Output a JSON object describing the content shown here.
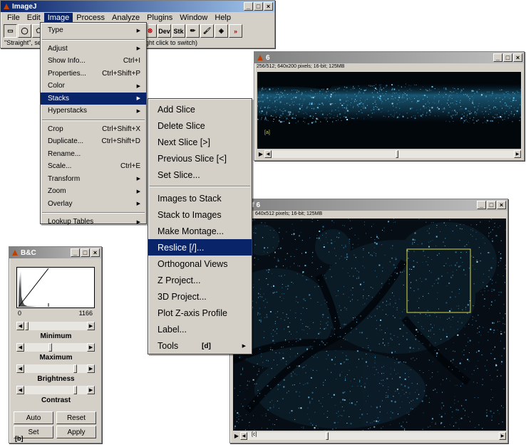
{
  "imagej": {
    "title": "ImageJ",
    "menus": [
      "File",
      "Edit",
      "Image",
      "Process",
      "Analyze",
      "Plugins",
      "Window",
      "Help"
    ],
    "active_menu": "Image",
    "tools": [
      {
        "name": "rectangle-tool-icon",
        "glyph": "▭"
      },
      {
        "name": "oval-tool-icon",
        "glyph": "◯"
      },
      {
        "name": "polygon-tool-icon",
        "glyph": "⬠"
      },
      {
        "name": "eyedropper-icon",
        "glyph": "✎"
      },
      {
        "name": "stop-icon",
        "glyph": "⊗"
      },
      {
        "name": "dev-tool-icon",
        "glyph": "Dev"
      },
      {
        "name": "stk-tool-icon",
        "glyph": "Stk"
      },
      {
        "name": "pencil-icon",
        "glyph": "✏"
      },
      {
        "name": "brush-icon",
        "glyph": "🖌"
      },
      {
        "name": "fill-bucket-icon",
        "glyph": "◈"
      },
      {
        "name": "more-tools-icon",
        "glyph": "»"
      }
    ],
    "status_left": "\"Straight\", se",
    "status_right": "ght click to switch)"
  },
  "image_menu": {
    "items": [
      {
        "label": "Type",
        "arrow": true
      },
      {
        "sep": true
      },
      {
        "label": "Adjust",
        "arrow": true
      },
      {
        "label": "Show Info...",
        "shortcut": "Ctrl+I"
      },
      {
        "label": "Properties...",
        "shortcut": "Ctrl+Shift+P"
      },
      {
        "label": "Color",
        "arrow": true
      },
      {
        "label": "Stacks",
        "arrow": true,
        "selected": true
      },
      {
        "label": "Hyperstacks",
        "arrow": true
      },
      {
        "sep": true
      },
      {
        "label": "Crop",
        "shortcut": "Ctrl+Shift+X"
      },
      {
        "label": "Duplicate...",
        "shortcut": "Ctrl+Shift+D"
      },
      {
        "label": "Rename..."
      },
      {
        "label": "Scale...",
        "shortcut": "Ctrl+E"
      },
      {
        "label": "Transform",
        "arrow": true
      },
      {
        "label": "Zoom",
        "arrow": true
      },
      {
        "label": "Overlay",
        "arrow": true
      },
      {
        "sep": true
      },
      {
        "label": "Lookup Tables",
        "arrow": true
      }
    ]
  },
  "stacks_menu": {
    "items": [
      {
        "label": "Add Slice"
      },
      {
        "label": "Delete Slice"
      },
      {
        "label": "Next Slice [>]"
      },
      {
        "label": "Previous Slice [<]"
      },
      {
        "label": "Set Slice..."
      },
      {
        "sep": true
      },
      {
        "label": "Images to Stack"
      },
      {
        "label": "Stack to Images"
      },
      {
        "label": "Make Montage..."
      },
      {
        "label": "Reslice [/]...",
        "selected": true
      },
      {
        "label": "Orthogonal Views"
      },
      {
        "label": "Z Project..."
      },
      {
        "label": "3D Project..."
      },
      {
        "label": "Plot Z-axis Profile"
      },
      {
        "label": "Label..."
      },
      {
        "label": "Tools",
        "arrow": true
      }
    ]
  },
  "reslice_window": {
    "title": "6",
    "info": "256/512; 640x200 pixels; 16-bit; 125MB",
    "corner_label": "[a]"
  },
  "stack_window": {
    "title": "e of 6",
    "info": "640x512 pixels; 16-bit; 125MB",
    "corner_label": "[c]"
  },
  "bc": {
    "title": "B&C",
    "min_value": "0",
    "max_value": "1166",
    "labels": [
      "Minimum",
      "Maximum",
      "Brightness",
      "Contrast"
    ],
    "slider_levels": [
      0.05,
      0.42,
      0.82,
      0.82
    ],
    "buttons": [
      "Auto",
      "Reset",
      "Set",
      "Apply"
    ],
    "tag": "[b]"
  },
  "panel_tags": {
    "d": "[d]"
  },
  "colors": {
    "menu_highlight": "#0a246a",
    "roi_yellow": "#d8d840",
    "signal_cyan": "#6fd0ff"
  }
}
